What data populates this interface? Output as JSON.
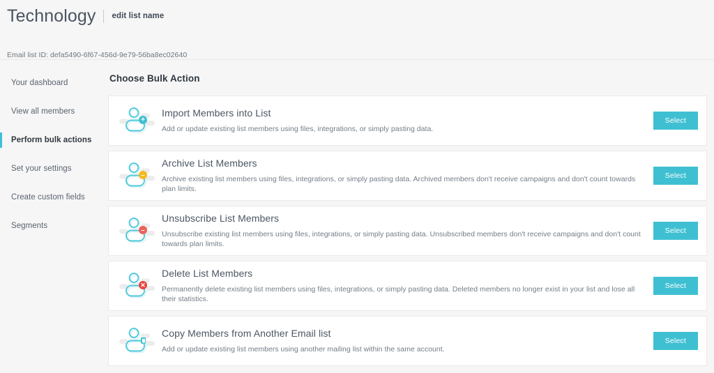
{
  "header": {
    "list_title": "Technology",
    "edit_link_label": "edit list name",
    "list_id_text": "Email list ID: defa5490-6f67-456d-9e79-56ba8ec02640"
  },
  "sidebar": {
    "items": [
      {
        "label": "Your dashboard",
        "active": false
      },
      {
        "label": "View all members",
        "active": false
      },
      {
        "label": "Perform bulk actions",
        "active": true
      },
      {
        "label": "Set your settings",
        "active": false
      },
      {
        "label": "Create custom fields",
        "active": false
      },
      {
        "label": "Segments",
        "active": false
      }
    ]
  },
  "main": {
    "section_title": "Choose Bulk Action",
    "select_button_label": "Select",
    "actions": [
      {
        "title": "Import Members into List",
        "description": "Add or update existing list members using files, integrations, or simply pasting data.",
        "icon": "member-add-icon",
        "badge_glyph": "+",
        "badge_color": "#3fc0d2"
      },
      {
        "title": "Archive List Members",
        "description": "Archive existing list members using files, integrations, or simply pasting data. Archived members don't receive campaigns and don't count towards plan limits.",
        "icon": "member-archive-icon",
        "badge_glyph": "–",
        "badge_color": "#f5b920"
      },
      {
        "title": "Unsubscribe List Members",
        "description": "Unsubscribe existing list members using files, integrations, or simply pasting data. Unsubscribed members don't receive campaigns and don't count towards plan limits.",
        "icon": "member-unsubscribe-icon",
        "badge_glyph": "–",
        "badge_color": "#e8645a"
      },
      {
        "title": "Delete List Members",
        "description": "Permanently delete existing list members using files, integrations, or simply pasting data. Deleted members no longer exist in your list and lose all their statistics.",
        "icon": "member-delete-icon",
        "badge_glyph": "✕",
        "badge_color": "#e8453c"
      },
      {
        "title": "Copy Members from Another Email list",
        "description": "Add or update existing list members using another mailing list within the same account.",
        "icon": "member-copy-icon",
        "badge_glyph": "",
        "badge_color": "#3fc0d2"
      }
    ]
  },
  "colors": {
    "accent": "#3fc0d2",
    "page_background": "#f6f6f6",
    "card_background": "#ffffff"
  }
}
